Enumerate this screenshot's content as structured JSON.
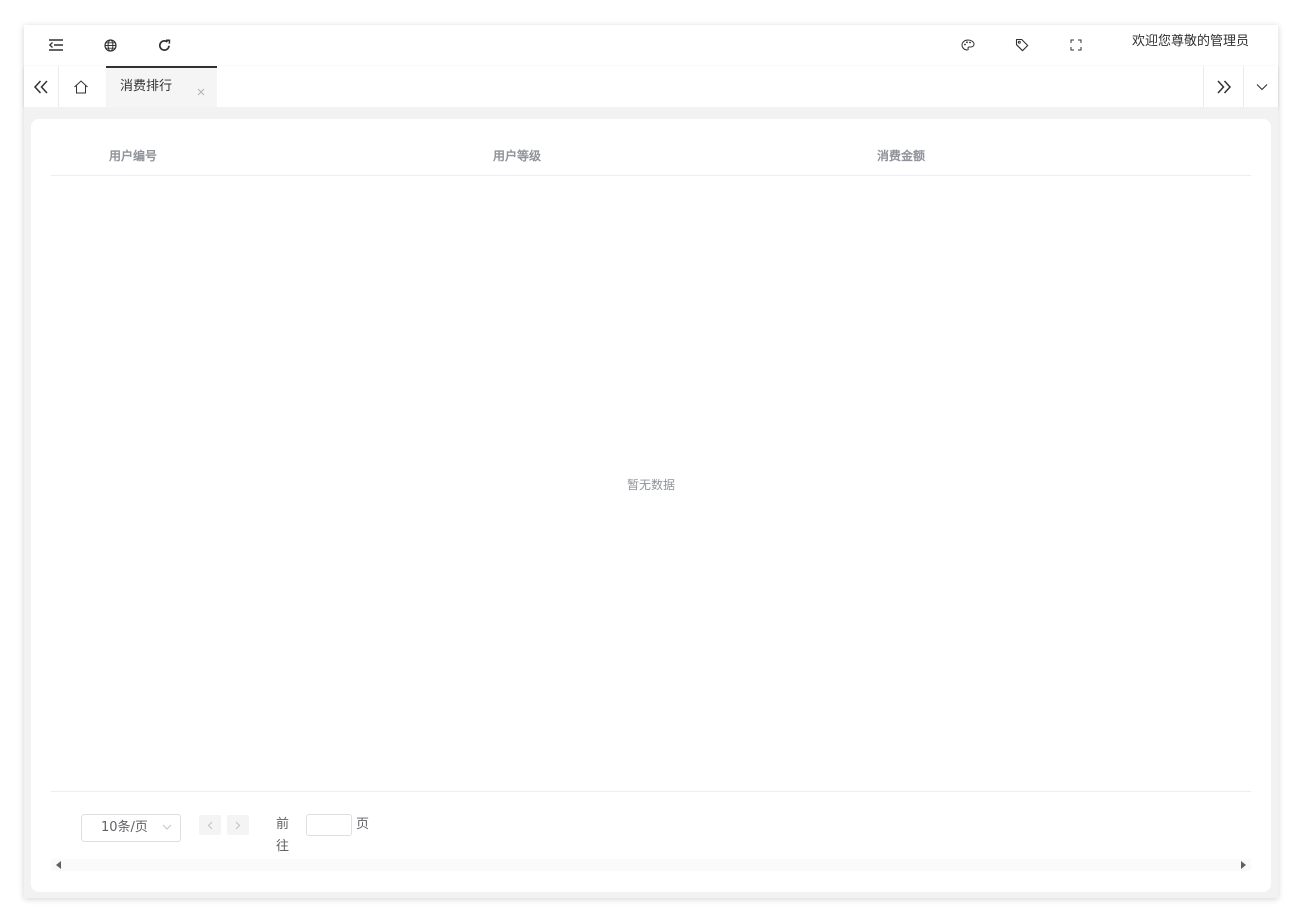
{
  "header": {
    "icons": [
      "menu-fold-icon",
      "globe-icon",
      "refresh-icon",
      "palette-icon",
      "tag-icon",
      "fullscreen-icon"
    ],
    "welcome_text": "欢迎您尊敬的管理员"
  },
  "tabs": {
    "active_label": "消费排行"
  },
  "table": {
    "columns": [
      "用户编号",
      "用户等级",
      "消费金额"
    ],
    "empty_text": "暂无数据"
  },
  "pagination": {
    "page_size_label": "10条/页",
    "goto_label": "前往",
    "goto_value": "",
    "page_suffix": "页"
  }
}
